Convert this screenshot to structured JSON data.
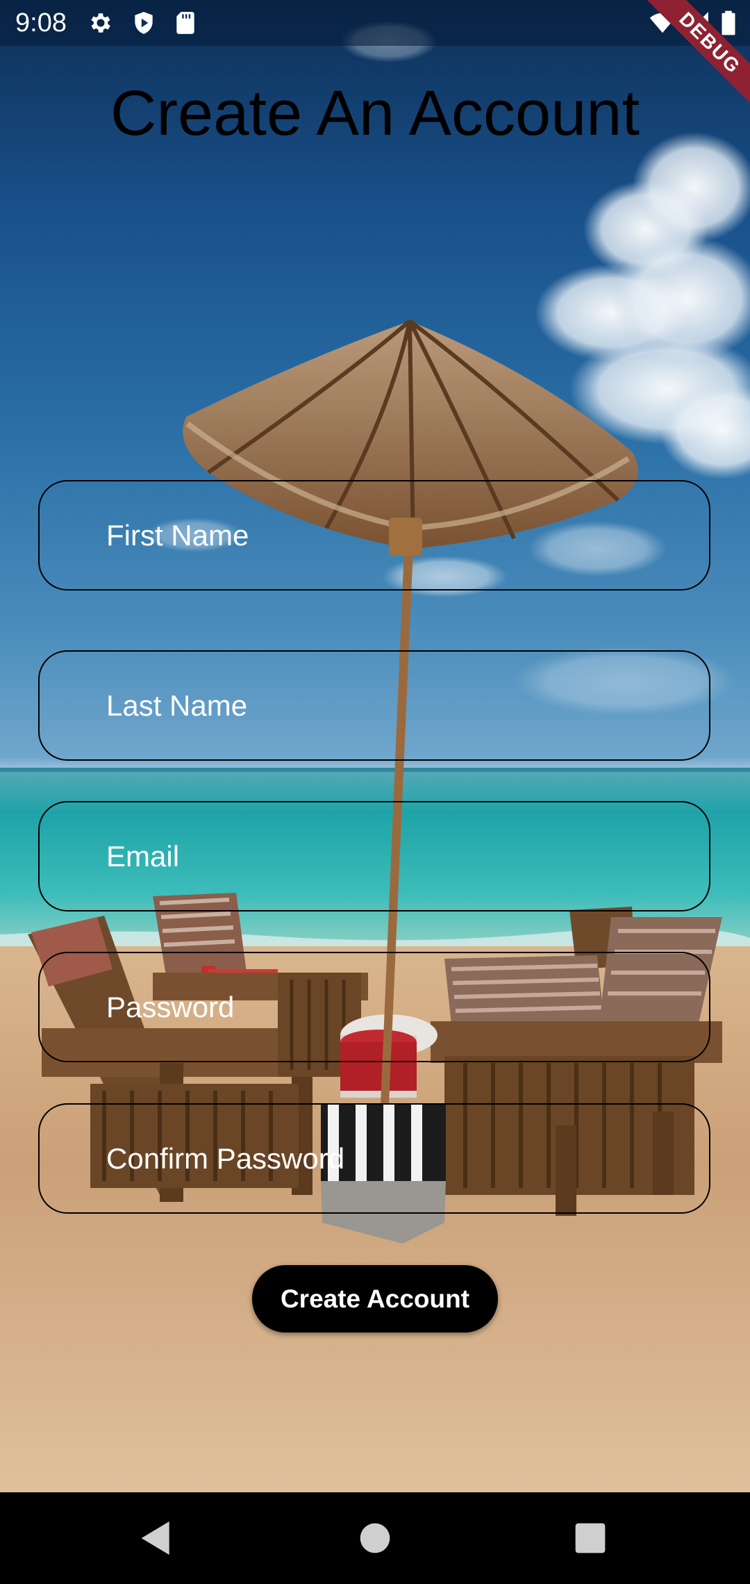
{
  "status_bar": {
    "time": "9:08",
    "left_icons": [
      "gear-icon",
      "play-protect-icon",
      "sd-card-icon"
    ],
    "right_icons": [
      "wifi-icon",
      "signal-icon",
      "battery-icon"
    ]
  },
  "debug_banner": {
    "label": "DEBUG",
    "color": "#8e2232"
  },
  "page": {
    "title": "Create An Account"
  },
  "form": {
    "fields": [
      {
        "label": "First Name"
      },
      {
        "label": "Last Name"
      },
      {
        "label": "Email"
      },
      {
        "label": "Password"
      },
      {
        "label": "Confirm Password"
      }
    ],
    "submit_label": "Create Account"
  },
  "nav_bar": {
    "buttons": [
      "back-icon",
      "home-icon",
      "recents-icon"
    ]
  }
}
